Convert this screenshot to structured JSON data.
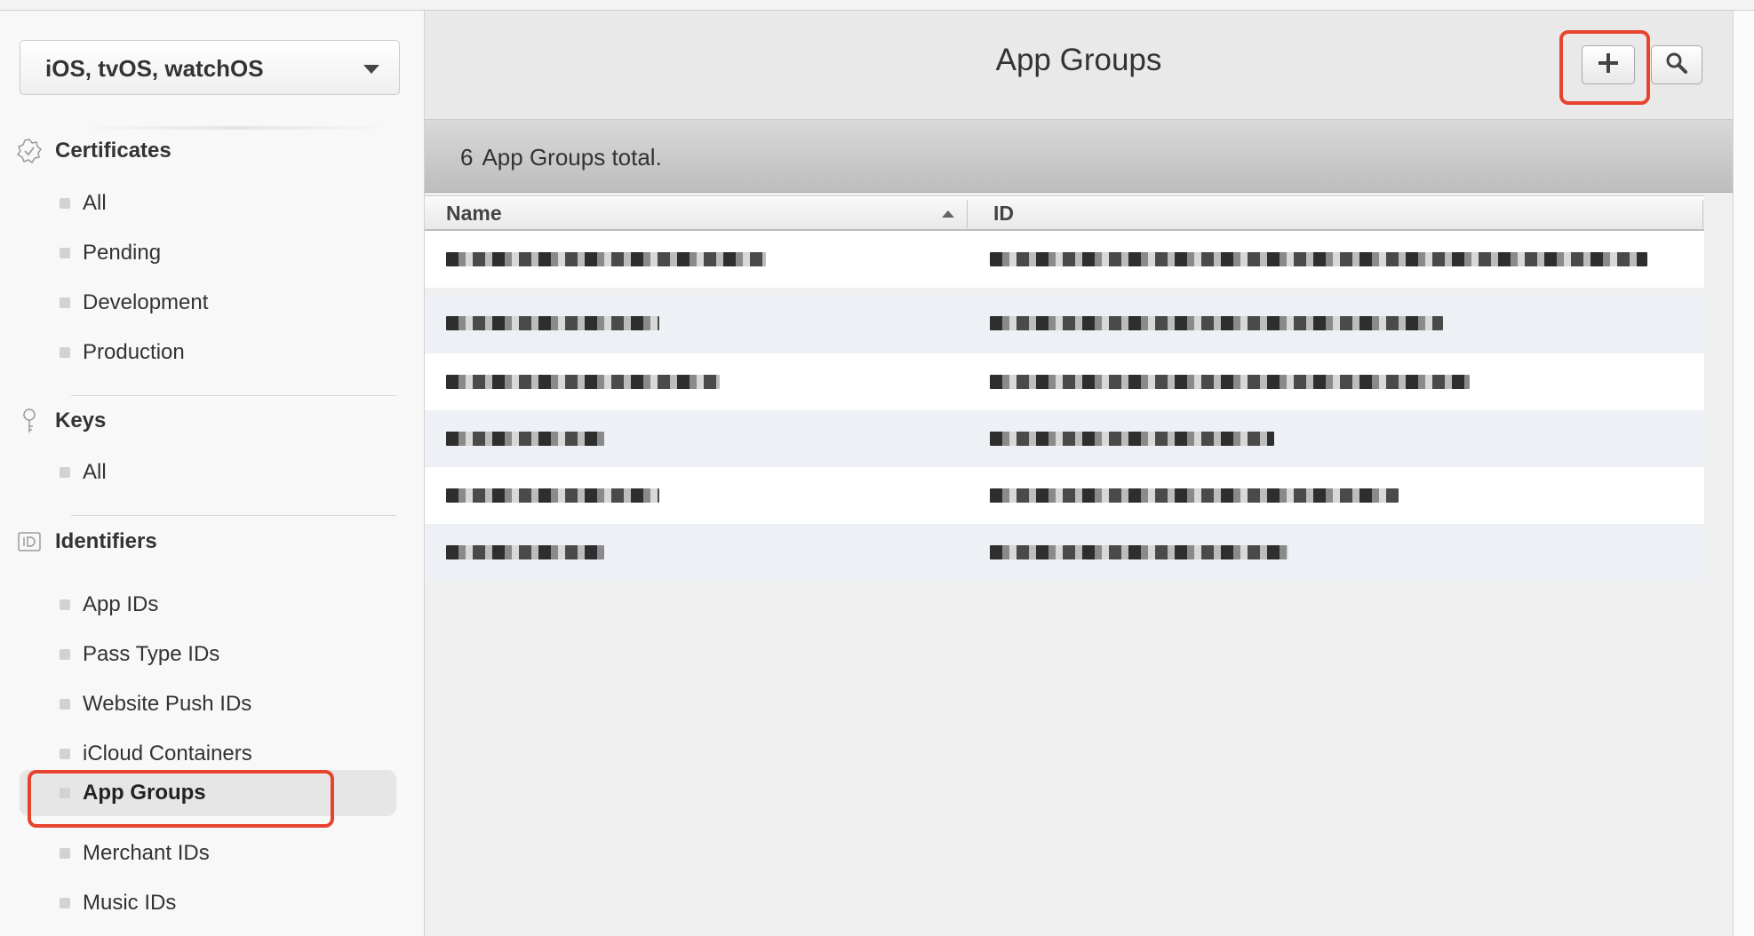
{
  "sidebar": {
    "platform_select": {
      "value": "iOS, tvOS, watchOS"
    },
    "sections": [
      {
        "title": "Certificates",
        "icon": "certificate-icon",
        "items": [
          "All",
          "Pending",
          "Development",
          "Production"
        ]
      },
      {
        "title": "Keys",
        "icon": "key-icon",
        "items": [
          "All"
        ]
      },
      {
        "title": "Identifiers",
        "icon": "id-icon",
        "items": [
          "App IDs",
          "Pass Type IDs",
          "Website Push IDs",
          "iCloud Containers",
          "App Groups",
          "Merchant IDs",
          "Music IDs"
        ]
      }
    ],
    "active_item": "App Groups"
  },
  "header": {
    "title": "App Groups",
    "add_icon": "plus-icon",
    "search_icon": "search-icon"
  },
  "summary": {
    "count": "6",
    "text": "App Groups total."
  },
  "table": {
    "columns": [
      "Name",
      "ID"
    ],
    "sorted_column": "Name",
    "sort_direction": "ascending",
    "row_count": 6
  },
  "colors": {
    "highlight": "#e8432e",
    "row_alt": "#edf1f6",
    "header_bg": "#e9e9e9"
  }
}
